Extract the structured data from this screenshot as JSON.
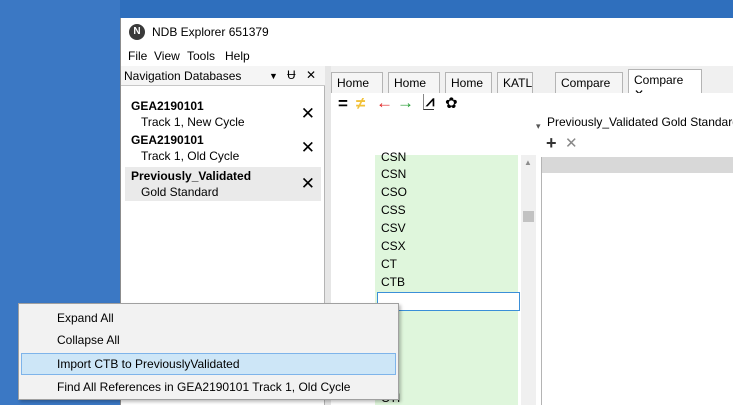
{
  "window": {
    "title": "NDB Explorer 651379",
    "icon": "app-logo-icon"
  },
  "menu": [
    "File",
    "View",
    "Tools",
    "Help"
  ],
  "nav": {
    "header": "Navigation Databases",
    "dropdown_glyph": "▼",
    "pin_glyph": "Ʉ",
    "close_glyph": "✕",
    "items": [
      {
        "name": "GEA2190101",
        "sub": "Track 1, New Cycle",
        "remove": "✕"
      },
      {
        "name": "GEA2190101",
        "sub": "Track 1, Old Cycle",
        "remove": "✕"
      },
      {
        "name": "Previously_Validated",
        "sub": "Gold Standard",
        "remove": "✕"
      }
    ]
  },
  "tabs": [
    "Home",
    "Home",
    "Home",
    "KATL",
    "Compare",
    "Compare ✕"
  ],
  "toolbar": {
    "equal": "=",
    "not_equal": "≠",
    "left": "←",
    "right": "→",
    "chart": "⩘",
    "gear": "✿",
    "plus": "+",
    "remove": "✕"
  },
  "compare_label": "Previously_Validated Gold Standard",
  "codes": [
    "CSN",
    "CSN",
    "CSO",
    "CSS",
    "CSV",
    "CSX",
    "CT",
    "CTB",
    "CTI"
  ],
  "context_menu": {
    "items": [
      "Expand All",
      "Collapse All",
      "Import CTB to PreviouslyValidated",
      "Find All References in GEA2190101 Track 1, Old Cycle"
    ],
    "highlighted_index": 2
  },
  "colors": {
    "desktop": "#2f6fbd",
    "match_green": "#dff6dc",
    "highlight": "#cde6f7",
    "not_equal_icon": "#f2c23a",
    "arrow_left_icon": "#e02020",
    "arrow_right_icon": "#1f9a2e"
  }
}
